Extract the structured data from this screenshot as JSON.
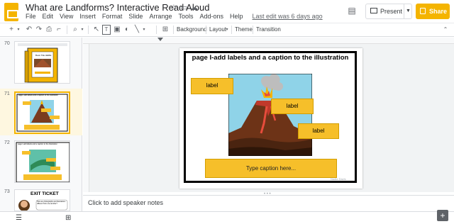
{
  "app": {
    "title": "What are Landforms? Interactive Read Aloud",
    "star_icon": "star-icon",
    "folder_icon": "folder-icon",
    "cloud_icon": "cloud-icon"
  },
  "menu": [
    "File",
    "Edit",
    "View",
    "Insert",
    "Format",
    "Slide",
    "Arrange",
    "Tools",
    "Add-ons",
    "Help"
  ],
  "last_edit": "Last edit was 6 days ago",
  "header": {
    "present_label": "Present",
    "share_label": "Share"
  },
  "toolbar": {
    "background_label": "Background",
    "layout_label": "Layout",
    "theme_label": "Theme",
    "transition_label": "Transition"
  },
  "filmstrip": {
    "slides": [
      {
        "number": "70",
        "text": "Book Title HERE"
      },
      {
        "number": "71",
        "text": "page I-add labels and a caption to the illustration",
        "selected": true
      },
      {
        "number": "72",
        "text": "page I-add labels and a caption to the illustration"
      },
      {
        "number": "73",
        "text": "EXIT TICKET",
        "subtext": "How are photographs and illustrations different from one another?"
      }
    ]
  },
  "slide": {
    "title": "page I-add labels and a caption to the illustration",
    "labels": [
      "label",
      "label",
      "label"
    ],
    "caption": "Type caption here...",
    "credit": "Nadia Davis"
  },
  "notes": {
    "placeholder": "Click to add speaker notes"
  },
  "colors": {
    "accent": "#f4b400",
    "label_fill": "#f6bf2a",
    "sky": "#8fd3e8",
    "lava": "#c0392b"
  }
}
